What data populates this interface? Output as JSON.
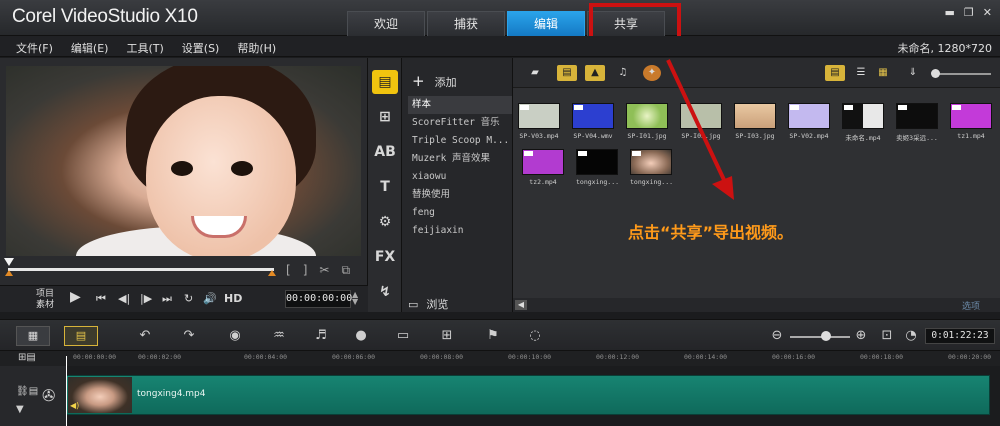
{
  "app": {
    "logo": "Corel VideoStudio X10",
    "tabs": [
      {
        "label": "欢迎",
        "active": false
      },
      {
        "label": "捕获",
        "active": false
      },
      {
        "label": "编辑",
        "active": true
      },
      {
        "label": "共享",
        "active": false
      }
    ],
    "accent_color": "#1f8fdc",
    "highlight_color": "#cc1111"
  },
  "menubar": {
    "items": [
      "文件(F)",
      "编辑(E)",
      "工具(T)",
      "设置(S)",
      "帮助(H)"
    ],
    "project_info": "未命名, 1280*720"
  },
  "preview": {
    "mode_project": "项目",
    "mode_clip": "素材",
    "hd_label": "HD",
    "timecode": "00:00:00:00"
  },
  "rail": {
    "items": [
      "media-icon",
      "instant-project-icon",
      "transition-icon",
      "title-icon",
      "graphic-icon",
      "filter-icon",
      "path-icon"
    ],
    "labels": [
      "",
      "",
      "AB",
      "T",
      "",
      "FX",
      ""
    ]
  },
  "library": {
    "add_label": "添加",
    "folders": [
      "样本",
      "ScoreFitter 音乐",
      "Triple Scoop M...",
      "Muzerk 声音效果",
      "xiaowu",
      "替换使用",
      "feng",
      "feijiaxin"
    ],
    "browse_label": "浏览",
    "options_label": "选项",
    "thumbnails": [
      {
        "label": "SP-V03.mp4",
        "color": "#c9cfc4"
      },
      {
        "label": "SP-V04.wmv",
        "color": "#2c3fd0"
      },
      {
        "label": "SP-I01.jpg",
        "color": "#8fbf57"
      },
      {
        "label": "SP-I02.jpg",
        "color": "#b8bfa9"
      },
      {
        "label": "SP-I03.jpg",
        "color": "#caa07a"
      },
      {
        "label": "SP-V02.mp4",
        "color": "#c3b9ef"
      },
      {
        "label": "未命名.mp4",
        "color": "#e8e8e8"
      },
      {
        "label": "卖姬3采远...",
        "color": "#0d0d0d"
      },
      {
        "label": "tz1.mp4",
        "color": "#c33ad9"
      },
      {
        "label": "tz2.mp4",
        "color": "#b23bd0"
      },
      {
        "label": "tongxing...",
        "color": "#050505"
      },
      {
        "label": "tongxing...",
        "color": "#e4bba5"
      }
    ]
  },
  "annotation": "点击“共享”导出视频。",
  "timeline": {
    "timecode": "0:01:22:23",
    "ruler": [
      "00:00:00:00",
      "00:00:02:00",
      "00:00:04:00",
      "00:00:06:00",
      "00:00:08:00",
      "00:00:10:00",
      "00:00:12:00",
      "00:00:14:00",
      "00:00:16:00",
      "00:00:18:00",
      "00:00:20:00"
    ],
    "clip_name": "tongxing4.mp4"
  }
}
